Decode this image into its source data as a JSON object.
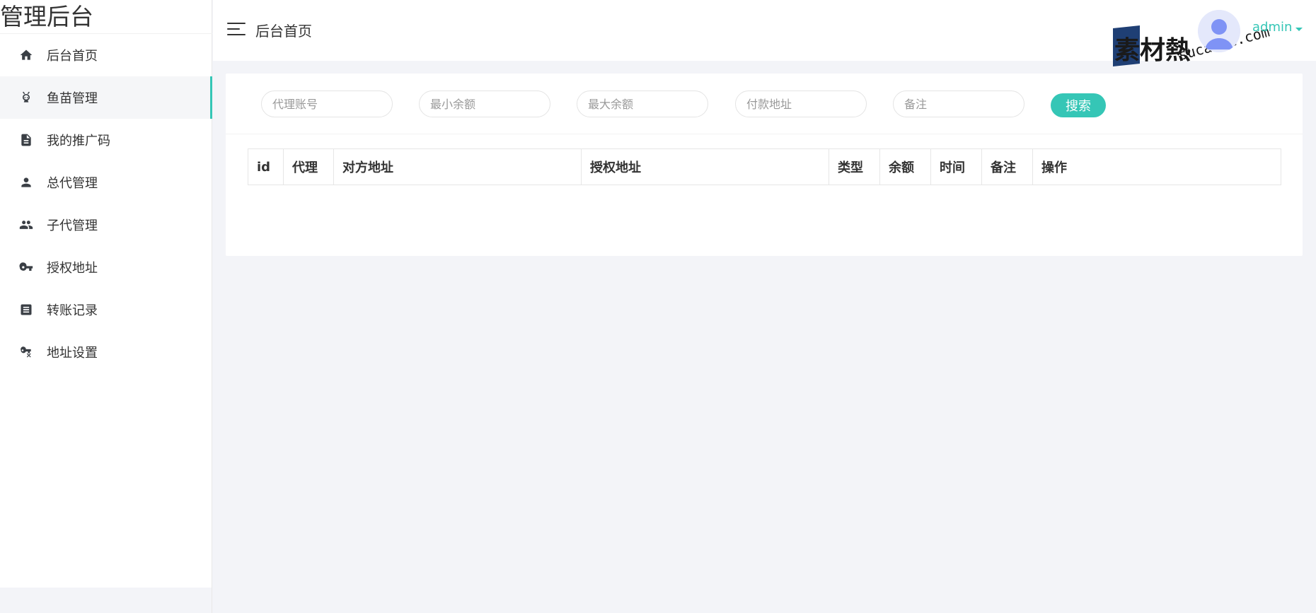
{
  "brand": {
    "title": "管理后台"
  },
  "sidebar": {
    "items": [
      {
        "label": "后台首页",
        "icon": "home-icon"
      },
      {
        "label": "鱼苗管理",
        "icon": "fish-icon",
        "active": true
      },
      {
        "label": "我的推广码",
        "icon": "document-icon"
      },
      {
        "label": "总代管理",
        "icon": "person-icon"
      },
      {
        "label": "子代管理",
        "icon": "people-icon"
      },
      {
        "label": "授权地址",
        "icon": "key-icon"
      },
      {
        "label": "转账记录",
        "icon": "record-icon"
      },
      {
        "label": "地址设置",
        "icon": "key-settings-icon"
      }
    ]
  },
  "header": {
    "title": "后台首页",
    "user_name": "admin"
  },
  "watermark": {
    "cn": "素材熱",
    "en": "sucaire.com"
  },
  "search": {
    "agent_account_placeholder": "代理账号",
    "min_balance_placeholder": "最小余额",
    "max_balance_placeholder": "最大余额",
    "payment_address_placeholder": "付款地址",
    "remark_placeholder": "备注",
    "button_label": "搜索"
  },
  "table": {
    "columns": [
      "id",
      "代理",
      "对方地址",
      "授权地址",
      "类型",
      "余额",
      "时间",
      "备注",
      "操作"
    ],
    "rows": []
  },
  "colors": {
    "accent": "#35c6b6",
    "background": "#f3f4f8"
  }
}
